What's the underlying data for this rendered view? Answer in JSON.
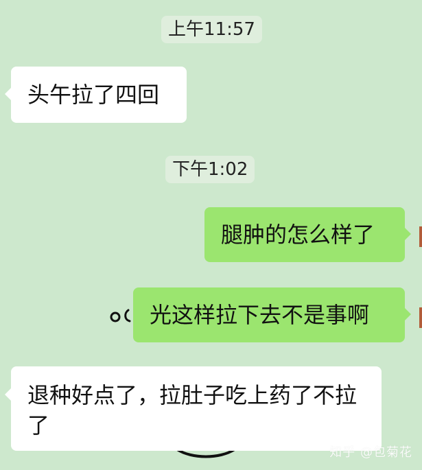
{
  "conversation": {
    "timestamps": [
      "上午11:57",
      "下午1:02"
    ],
    "messages": [
      {
        "direction": "incoming",
        "text": "头午拉了四回"
      },
      {
        "direction": "outgoing",
        "text": "腿肿的怎么样了"
      },
      {
        "direction": "outgoing",
        "text": "光这样拉下去不是事啊"
      },
      {
        "direction": "incoming",
        "text": "退种好点了，拉肚子吃上药了不拉了"
      }
    ]
  },
  "colors": {
    "background": "#cde8cd",
    "incoming_bubble": "#ffffff",
    "outgoing_bubble": "#9be56f",
    "timestamp_bg": "#dfeedd"
  },
  "watermark": "知乎 @包菊花"
}
